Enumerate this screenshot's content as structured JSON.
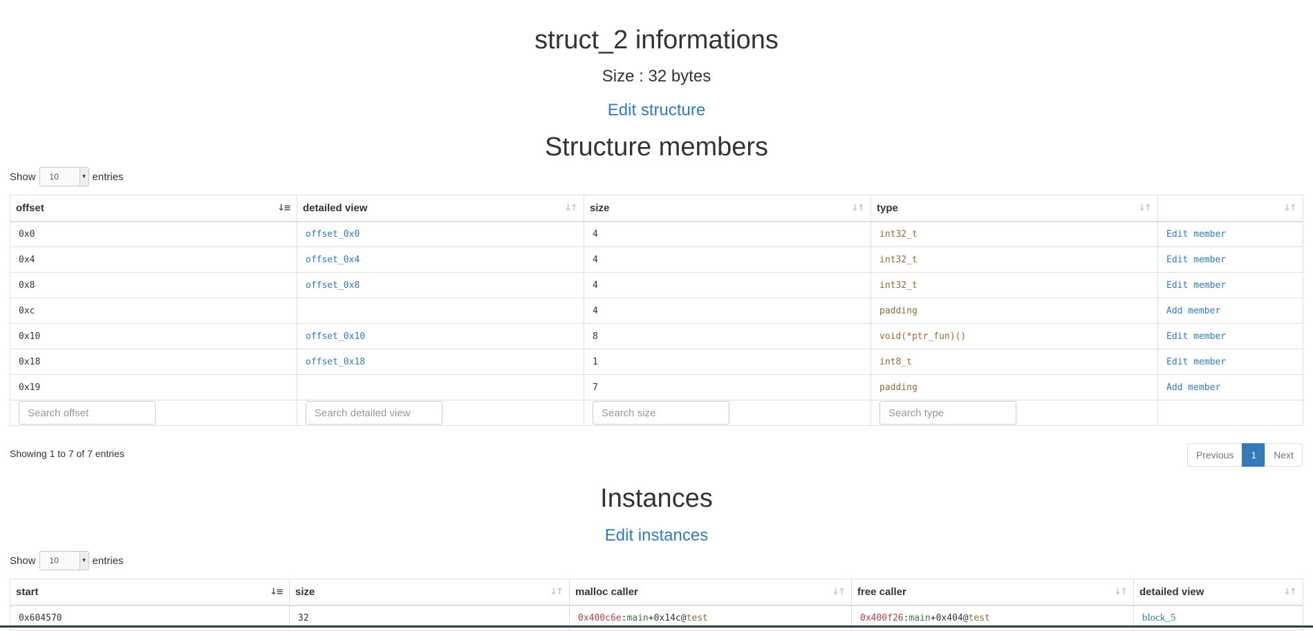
{
  "header": {
    "title": "struct_2 informations",
    "size_text": "Size : 32 bytes",
    "edit_structure": "Edit structure"
  },
  "members": {
    "section_title": "Structure members",
    "length": {
      "show": "Show",
      "value": "10",
      "entries": "entries"
    },
    "columns": [
      "offset",
      "detailed view",
      "size",
      "type",
      ""
    ],
    "rows": [
      {
        "offset": "0x0",
        "detailed": "offset_0x0",
        "size": "4",
        "type": "int32_t",
        "action": "Edit member"
      },
      {
        "offset": "0x4",
        "detailed": "offset_0x4",
        "size": "4",
        "type": "int32_t",
        "action": "Edit member"
      },
      {
        "offset": "0x8",
        "detailed": "offset_0x8",
        "size": "4",
        "type": "int32_t",
        "action": "Edit member"
      },
      {
        "offset": "0xc",
        "detailed": "",
        "size": "4",
        "type": "padding",
        "action": "Add member"
      },
      {
        "offset": "0x10",
        "detailed": "offset_0x10",
        "size": "8",
        "type": "void(*ptr_fun)()",
        "action": "Edit member"
      },
      {
        "offset": "0x18",
        "detailed": "offset_0x18",
        "size": "1",
        "type": "int8_t",
        "action": "Edit member"
      },
      {
        "offset": "0x19",
        "detailed": "",
        "size": "7",
        "type": "padding",
        "action": "Add member"
      }
    ],
    "search_placeholders": {
      "offset": "Search offset",
      "detailed": "Search detailed view",
      "size": "Search size",
      "type": "Search type"
    },
    "info": "Showing 1 to 7 of 7 entries",
    "pagination": {
      "previous": "Previous",
      "current": "1",
      "next": "Next"
    }
  },
  "instances": {
    "section_title": "Instances",
    "edit_instances": "Edit instances",
    "length": {
      "show": "Show",
      "value": "10",
      "entries": "entries"
    },
    "columns": [
      "start",
      "size",
      "malloc caller",
      "free caller",
      "detailed view"
    ],
    "rows": [
      {
        "start": "0x604570",
        "size": "32",
        "malloc_addr": "0x400c6e",
        "malloc_sep": ":",
        "malloc_fn": "main",
        "malloc_off": "+0x14c@",
        "malloc_file": "test",
        "free_addr": "0x400f26",
        "free_sep": ":",
        "free_fn": "main",
        "free_off": "+0x404@",
        "free_file": "test",
        "detailed": "block_5"
      }
    ]
  },
  "colors": {
    "link": "#337ab7",
    "type_text": "#8a6d3b",
    "address": "#a94442",
    "function": "#3c763d",
    "page_active": "#337ab7"
  },
  "icons": {
    "sort_active": "sort-amount-asc-icon",
    "sort_inactive": "sort-both-icon",
    "select_caret": "caret-down-icon"
  }
}
